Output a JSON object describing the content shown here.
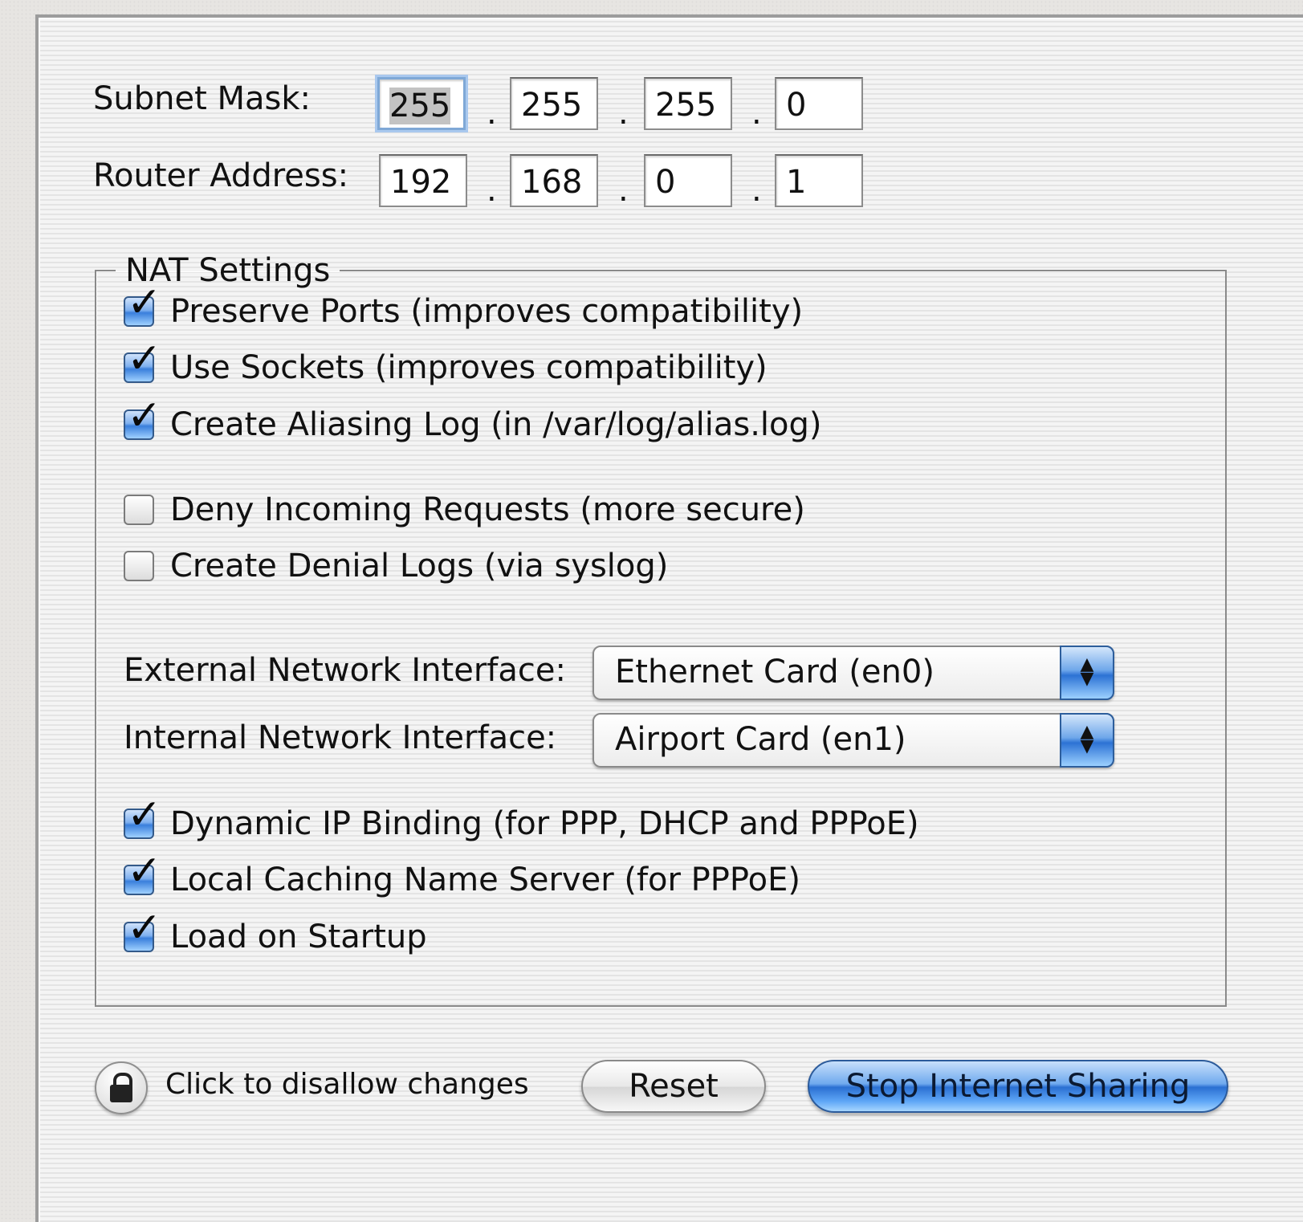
{
  "subnet": {
    "label": "Subnet Mask:",
    "octets": [
      "255",
      "255",
      "255",
      "0"
    ]
  },
  "router": {
    "label": "Router Address:",
    "octets": [
      "192",
      "168",
      "0",
      "1"
    ]
  },
  "separator": ".",
  "nat": {
    "title": "NAT Settings",
    "options": [
      {
        "label": "Preserve Ports (improves compatibility)",
        "checked": true
      },
      {
        "label": "Use Sockets (improves compatibility)",
        "checked": true
      },
      {
        "label": "Create Aliasing Log (in /var/log/alias.log)",
        "checked": true
      },
      {
        "label": "Deny Incoming Requests (more secure)",
        "checked": false
      },
      {
        "label": "Create Denial Logs (via syslog)",
        "checked": false
      },
      {
        "label": "Dynamic IP Binding (for PPP, DHCP and PPPoE)",
        "checked": true
      },
      {
        "label": "Local Caching Name Server (for PPPoE)",
        "checked": true
      },
      {
        "label": "Load on Startup",
        "checked": true
      }
    ],
    "external": {
      "label": "External Network Interface:",
      "value": "Ethernet Card (en0)"
    },
    "internal": {
      "label": "Internal Network Interface:",
      "value": "Airport Card (en1)"
    }
  },
  "footer": {
    "lock_text": "Click to disallow changes",
    "reset_label": "Reset",
    "stop_label": "Stop Internet Sharing"
  },
  "colors": {
    "accent": "#3a7fdc",
    "default_button": "#2a6fd2"
  }
}
